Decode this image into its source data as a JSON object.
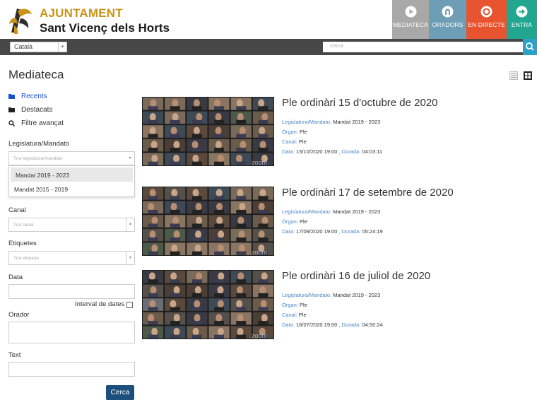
{
  "header": {
    "brand_line1": "AJUNTAMENT",
    "brand_line2": "Sant Vicenç dels Horts",
    "nav": [
      {
        "label": "MEDIATECA",
        "icon": "play-icon",
        "color": "#a8a8a8"
      },
      {
        "label": "ORADORS",
        "icon": "person-icon",
        "color": "#6e9eb6"
      },
      {
        "label": "EN DIRECTE",
        "icon": "live-icon",
        "color": "#e8542f"
      },
      {
        "label": "ENTRA",
        "icon": "login-arrow-icon",
        "color": "#23a690"
      }
    ]
  },
  "toolbar": {
    "language": "Català",
    "search_placeholder": "Cerca"
  },
  "page": {
    "title": "Mediateca"
  },
  "sidebar": {
    "links": [
      {
        "label": "Recents",
        "icon": "folder-icon"
      },
      {
        "label": "Destacats",
        "icon": "folder-icon"
      },
      {
        "label": "Filtre avançat",
        "icon": "search-icon"
      }
    ],
    "legislatura": {
      "label": "Legislatura/Mandato",
      "placeholder": "Tria legislatura/mandato",
      "options": [
        "Mandat 2019 - 2023",
        "Mandat 2015 - 2019"
      ]
    },
    "canal": {
      "label": "Canal",
      "placeholder": "Tria canal"
    },
    "etiquetes": {
      "label": "Etiquetes",
      "placeholder": "Tria etiqueta"
    },
    "data": {
      "label": "Data",
      "interval_label": "Interval de dates"
    },
    "orador": {
      "label": "Orador"
    },
    "text": {
      "label": "Text"
    },
    "submit": "Cerca"
  },
  "results": [
    {
      "title": "Ple ordinàri 15 d'octubre de 2020",
      "legislatura_key": "Legislatura/Mandato:",
      "legislatura": "Mandat 2019 - 2023",
      "organ_key": "Òrgan:",
      "organ": "Ple",
      "canal_key": "Canal:",
      "canal": "Ple",
      "data_key": "Data:",
      "data": "15/10/2020 19:00",
      "durada_key": ", Durada:",
      "durada": "04:03:11",
      "watermark": "zoom"
    },
    {
      "title": "Ple ordinàri 17 de setembre de 2020",
      "legislatura_key": "Legislatura/Mandato:",
      "legislatura": "Mandat 2019 - 2023",
      "organ_key": "Òrgan:",
      "organ": "Ple",
      "data_key": "Data:",
      "data": "17/09/2020 19:00",
      "durada_key": ", Durada:",
      "durada": "05:24:19",
      "watermark": "zoom"
    },
    {
      "title": "Ple ordinàri 16 de juliol de 2020",
      "legislatura_key": "Legislatura/Mandato:",
      "legislatura": "Mandat 2019 - 2023",
      "organ_key": "Òrgan:",
      "organ": "Ple",
      "canal_key": "Canal:",
      "canal": "Ple",
      "data_key": "Data:",
      "data": "16/07/2020 19:00",
      "durada_key": ", Durada:",
      "durada": "04:50:24",
      "watermark": "zoom"
    }
  ],
  "colors": {
    "brand_gold": "#c8951a",
    "link_blue": "#1a4fd0",
    "meta_key_blue": "#4a86c4",
    "toolbar": "#474747",
    "search_button": "#2aa3c9",
    "cerca_button": "#1d4f7c"
  }
}
